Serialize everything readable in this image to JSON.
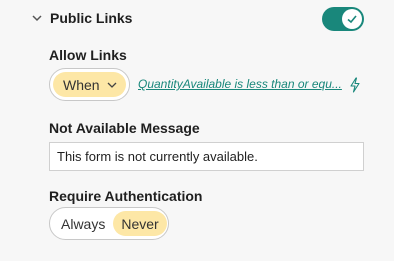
{
  "section": {
    "title": "Public Links",
    "enabled": true
  },
  "allow_links": {
    "label": "Allow Links",
    "selected": "When",
    "condition": "QuantityAvailable is less than or equ..."
  },
  "not_available": {
    "label": "Not Available Message",
    "value": "This form is not currently available."
  },
  "require_auth": {
    "label": "Require Authentication",
    "options": [
      "Always",
      "Never"
    ],
    "selected": "Never"
  },
  "colors": {
    "accent": "#19877b",
    "selected_pill": "#fde7a6"
  },
  "icons": {
    "collapse": "chevron-down-icon",
    "toggle_check": "checkmark-icon",
    "dropdown": "chevron-down-icon",
    "expression": "lightning-bolt-icon"
  }
}
